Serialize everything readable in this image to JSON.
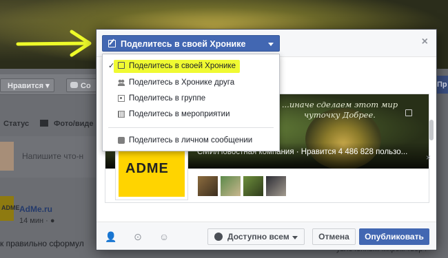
{
  "background": {
    "like_label": "Нравится",
    "comment_label": "Со",
    "status_label": "Статус",
    "photo_label": "Фото/виде",
    "composer_placeholder": "Напишите что-н",
    "post_author": "AdMe.ru",
    "post_time": "14 мин · ",
    "post_text": "к правильно сформул",
    "post_logo_text": "ADME",
    "right_button_label": "Пр",
    "right_text": "увлеченным миром творч"
  },
  "dialog": {
    "share_selector": {
      "label": "Поделитесь в своей Хронике",
      "accent_color": "#4267b2"
    },
    "close_label": "×",
    "menu": {
      "items": [
        {
          "label": "Поделитесь в своей Хронике",
          "icon": "edit-icon",
          "checked": true,
          "highlighted": true
        },
        {
          "label": "Поделитесь в Хронике друга",
          "icon": "friend-icon"
        },
        {
          "label": "Поделитесь в группе",
          "icon": "group-icon"
        },
        {
          "label": "Поделитесь в мероприятии",
          "icon": "event-icon"
        },
        {
          "label": "Поделитесь в личном сообщении",
          "icon": "message-icon"
        }
      ],
      "check_mark": "✓"
    },
    "preview": {
      "quote": "...иначе сделаем этот мир чуточку Добрее.",
      "page_meta": "СМИ/Новостная компания · Нравится 4 486 828 пользо...",
      "logo_text": "ADME",
      "highlight_color": "#f0fa32"
    },
    "footer": {
      "audience_label": "Доступно всем",
      "cancel_label": "Отмена",
      "publish_label": "Опубликовать"
    }
  }
}
